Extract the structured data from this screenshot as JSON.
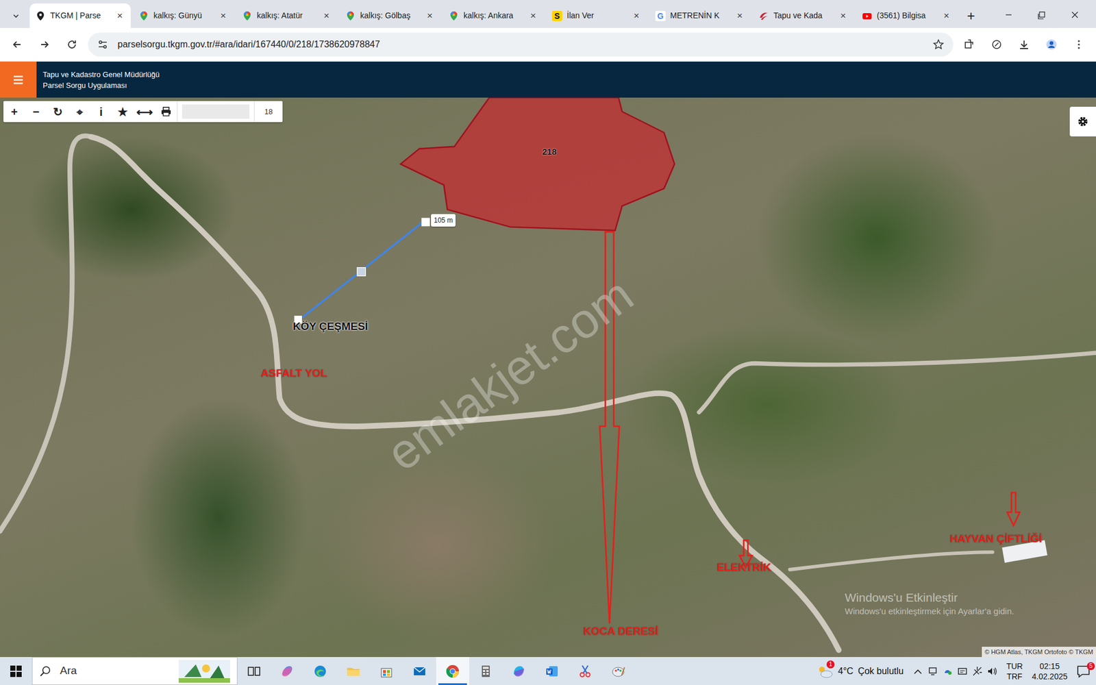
{
  "browser": {
    "tabs": [
      {
        "label": "TKGM | Parse",
        "icon": "pin",
        "selected": true
      },
      {
        "label": "kalkış: Günyü",
        "icon": "maps",
        "selected": false
      },
      {
        "label": "kalkış: Atatür",
        "icon": "maps",
        "selected": false
      },
      {
        "label": "kalkış: Gölbaş",
        "icon": "maps",
        "selected": false
      },
      {
        "label": "kalkış: Ankara",
        "icon": "maps",
        "selected": false
      },
      {
        "label": "İlan Ver",
        "icon": "letter",
        "icon_text": "S",
        "selected": false
      },
      {
        "label": "METRENİN K",
        "icon": "letter",
        "icon_text": "G",
        "selected": false
      },
      {
        "label": "Tapu ve Kada",
        "icon": "tkgm",
        "selected": false
      },
      {
        "label": "(3561) Bilgisa",
        "icon": "youtube",
        "selected": false
      }
    ],
    "close": "×",
    "new_tab": "+",
    "address": "parselsorgu.tkgm.gov.tr/#ara/idari/167440/0/218/1738620978847"
  },
  "app": {
    "title": "Tapu ve Kadastro Genel Müdürlüğü",
    "subtitle": "Parsel Sorgu Uygulaması",
    "toolbar": [
      {
        "kind": "glyph",
        "text": "+"
      },
      {
        "kind": "glyph",
        "text": "−"
      },
      {
        "kind": "glyph",
        "text": "↻"
      },
      {
        "kind": "glyph",
        "text": "⌖"
      },
      {
        "kind": "glyph",
        "text": "i"
      },
      {
        "kind": "glyph",
        "text": "★"
      },
      {
        "kind": "glyph",
        "text": "⟷"
      },
      {
        "kind": "print"
      }
    ],
    "zoom": "18"
  },
  "map": {
    "parcel_label": "218",
    "measure": "105 m",
    "labels": [
      {
        "text": "KÖY ÇEŞMESİ",
        "color": "#111111"
      },
      {
        "text": "ASFALT YOL",
        "color": "#e3211c"
      },
      {
        "text": "KOCA DERESİ",
        "color": "#e3211c"
      },
      {
        "text": "ELEKTRİK",
        "color": "#e3211c"
      },
      {
        "text": "HAYVAN ÇİFTLİĞİ",
        "color": "#e3211c"
      }
    ],
    "watermark": "emlakjet.com",
    "activation": [
      "Windows'u Etkinleştir",
      "Windows'u etkinleştirmek için Ayarlar'a gidin."
    ],
    "attribution": "© HGM Atlas, TKGM Ortofoto © TKGM"
  },
  "taskbar": {
    "search": "Ara",
    "apps": [
      {
        "icon": "taskview",
        "selected": false
      },
      {
        "icon": "copilot",
        "selected": false
      },
      {
        "icon": "edge",
        "selected": false
      },
      {
        "icon": "explorer",
        "selected": false
      },
      {
        "icon": "store",
        "selected": false
      },
      {
        "icon": "mail",
        "selected": false
      },
      {
        "icon": "chrome",
        "selected": true
      },
      {
        "icon": "calculator",
        "selected": false
      },
      {
        "icon": "m365",
        "selected": false
      },
      {
        "icon": "word",
        "selected": false
      },
      {
        "icon": "snip",
        "selected": false
      },
      {
        "icon": "paint",
        "selected": false
      }
    ],
    "weather_badge": "1",
    "temperature": "4°C",
    "weather": "Çok bulutlu",
    "lang_top": "TUR",
    "lang_bottom": "TRF",
    "time": "02:15",
    "date": "4.02.2025",
    "notifications": "5"
  }
}
